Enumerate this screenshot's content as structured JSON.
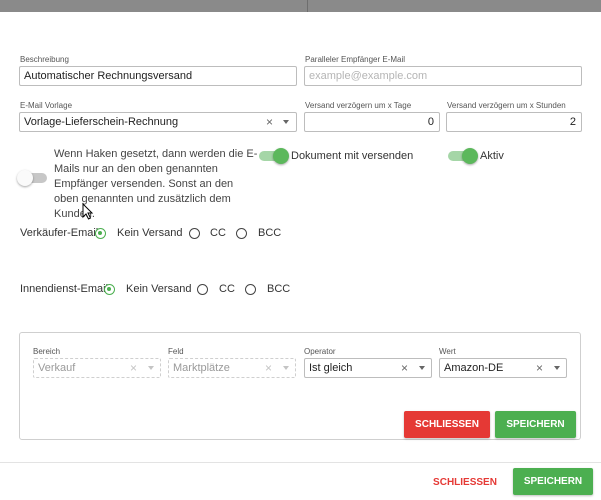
{
  "form": {
    "beschreibung": {
      "label": "Beschreibung",
      "value": "Automatischer Rechnungsversand"
    },
    "paralleler_empfaenger": {
      "label": "Paralleler Empfänger E-Mail",
      "placeholder": "example@example.com",
      "value": ""
    },
    "email_vorlage": {
      "label": "E-Mail Vorlage",
      "value": "Vorlage-Lieferschein-Rechnung",
      "clear": "×"
    },
    "verzoegern_tage": {
      "label": "Versand verzögern um x Tage",
      "value": "0"
    },
    "verzoegern_stunden": {
      "label": "Versand verzögern um x Stunden",
      "value": "2"
    },
    "toggle_help_text": "Wenn Haken gesetzt, dann werden die E-Mails nur an den oben genannten Empfänger versenden. Sonst an den oben genannten und zusätzlich dem Kunden.",
    "dokument_mit_versenden": {
      "label": "Dokument mit versenden",
      "checked": true
    },
    "aktiv": {
      "label": "Aktiv",
      "checked": true
    },
    "nur_empfaenger_toggle": {
      "checked": false
    }
  },
  "verkaeufer_email": {
    "label": "Verkäufer-Email",
    "options": [
      "Kein Versand",
      "CC",
      "BCC"
    ],
    "selected": "Kein Versand"
  },
  "innendienst_email": {
    "label": "Innendienst-Email",
    "options": [
      "Kein Versand",
      "CC",
      "BCC"
    ],
    "selected": "Kein Versand"
  },
  "filter": {
    "bereich": {
      "label": "Bereich",
      "value": "Verkauf",
      "clear": "×"
    },
    "feld": {
      "label": "Feld",
      "value": "Marktplätze",
      "clear": "×"
    },
    "operator": {
      "label": "Operator",
      "value": "Ist gleich",
      "clear": "×"
    },
    "wert": {
      "label": "Wert",
      "value": "Amazon-DE",
      "clear": "×"
    },
    "close_label": "SCHLIESSEN",
    "save_label": "SPEICHERN"
  },
  "footer": {
    "close_label": "SCHLIESSEN",
    "save_label": "SPEICHERN"
  },
  "colors": {
    "green": "#4caf50",
    "red": "#e53935",
    "toggle_track_on": "#a5d6a7"
  }
}
